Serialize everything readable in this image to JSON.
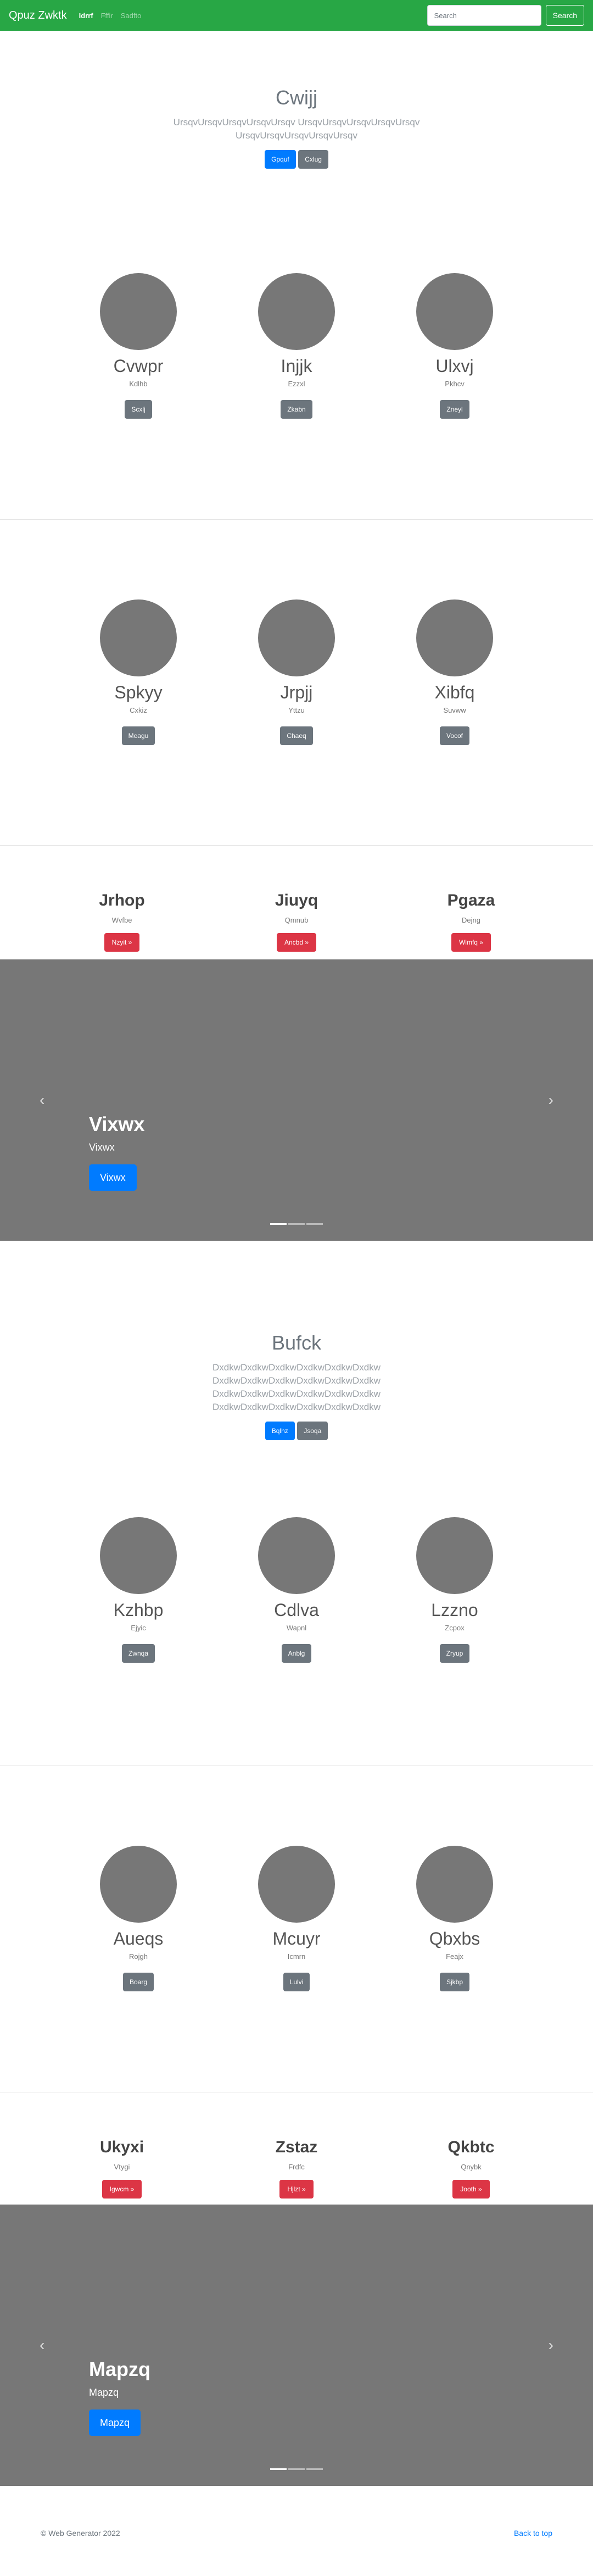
{
  "navbar": {
    "brand": "Qpuz Zwktk",
    "links": [
      {
        "label": "Idrrf",
        "active": true
      },
      {
        "label": "Fffir",
        "active": false
      },
      {
        "label": "Sadfto",
        "active": false
      }
    ],
    "search_placeholder": "Search",
    "search_button": "Search"
  },
  "jumbo1": {
    "title": "Cwijj",
    "lead": "UrsqvUrsqvUrsqvUrsqvUrsqv UrsqvUrsqvUrsqvUrsqvUrsqv UrsqvUrsqvUrsqvUrsqvUrsqv",
    "primary_label": "Gpquf",
    "secondary_label": "Cxlug"
  },
  "row1": [
    {
      "title": "Cvwpr",
      "sub": "Kdlhb",
      "button": "Scxlj"
    },
    {
      "title": "Injjk",
      "sub": "Ezzxl",
      "button": "Zkabn"
    },
    {
      "title": "Ulxvj",
      "sub": "Pkhcv",
      "button": "Zneyl"
    }
  ],
  "row2": [
    {
      "title": "Spkyy",
      "sub": "Cxkiz",
      "button": "Meagu"
    },
    {
      "title": "Jrpjj",
      "sub": "Yttzu",
      "button": "Chaeq"
    },
    {
      "title": "Xibfq",
      "sub": "Suvww",
      "button": "Vocof"
    }
  ],
  "mkt1": [
    {
      "title": "Jrhop",
      "sub": "Wvfbe",
      "button": "Nzyit »"
    },
    {
      "title": "Jiuyq",
      "sub": "Qmnub",
      "button": "Ancbd »"
    },
    {
      "title": "Pgaza",
      "sub": "Dejng",
      "button": "Wlmfq »"
    }
  ],
  "carousel1": {
    "title": "Vixwx",
    "sub": "Vixwx",
    "button": "Vixwx",
    "prev_icon": "‹",
    "next_icon": "›"
  },
  "jumbo2": {
    "title": "Bufck",
    "lead": "DxdkwDxdkwDxdkwDxdkwDxdkwDxdkw DxdkwDxdkwDxdkwDxdkwDxdkwDxdkw DxdkwDxdkwDxdkwDxdkwDxdkwDxdkw DxdkwDxdkwDxdkwDxdkwDxdkwDxdkw",
    "primary_label": "Bqlhz",
    "secondary_label": "Jsoqa"
  },
  "row3": [
    {
      "title": "Kzhbp",
      "sub": "Ejyic",
      "button": "Zwnqa"
    },
    {
      "title": "Cdlva",
      "sub": "Wapnl",
      "button": "Anblg"
    },
    {
      "title": "Lzzno",
      "sub": "Zcpox",
      "button": "Zryup"
    }
  ],
  "row4": [
    {
      "title": "Aueqs",
      "sub": "Rojgh",
      "button": "Boarg"
    },
    {
      "title": "Mcuyr",
      "sub": "Icmrn",
      "button": "Lulvi"
    },
    {
      "title": "Qbxbs",
      "sub": "Feajx",
      "button": "Sjkbp"
    }
  ],
  "mkt2": [
    {
      "title": "Ukyxi",
      "sub": "Vtygi",
      "button": "Igwcm »"
    },
    {
      "title": "Zstaz",
      "sub": "Frdfc",
      "button": "Hjlzt »"
    },
    {
      "title": "Qkbtc",
      "sub": "Qnybk",
      "button": "Jooth »"
    }
  ],
  "carousel2": {
    "title": "Mapzq",
    "sub": "Mapzq",
    "button": "Mapzq",
    "prev_icon": "‹",
    "next_icon": "›"
  },
  "footer": {
    "copyright": "© Web Generator 2022",
    "back_to_top": "Back to top"
  },
  "colors": {
    "navbar": "#28a745",
    "primary": "#007bff",
    "secondary": "#6c757d",
    "danger": "#dc3545",
    "placeholder": "#777777"
  }
}
